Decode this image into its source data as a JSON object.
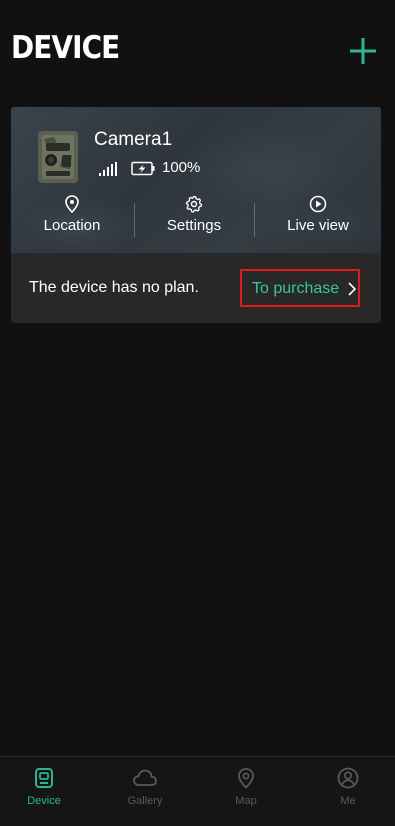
{
  "header": {
    "title": "DEVICE"
  },
  "device": {
    "name": "Camera1",
    "battery": "100%",
    "actions": {
      "location": "Location",
      "settings": "Settings",
      "live_view": "Live view"
    },
    "plan_text": "The device has no plan.",
    "purchase_label": "To purchase"
  },
  "tabs": [
    {
      "label": "Device",
      "icon": "device-icon",
      "active": true
    },
    {
      "label": "Gallery",
      "icon": "cloud-icon",
      "active": false
    },
    {
      "label": "Map",
      "icon": "map-pin-icon",
      "active": false
    },
    {
      "label": "Me",
      "icon": "user-icon",
      "active": false
    }
  ],
  "colors": {
    "accent": "#2fb58f",
    "purchase_text": "#35c6a6",
    "highlight_border": "#e0191c",
    "background": "#111111"
  }
}
